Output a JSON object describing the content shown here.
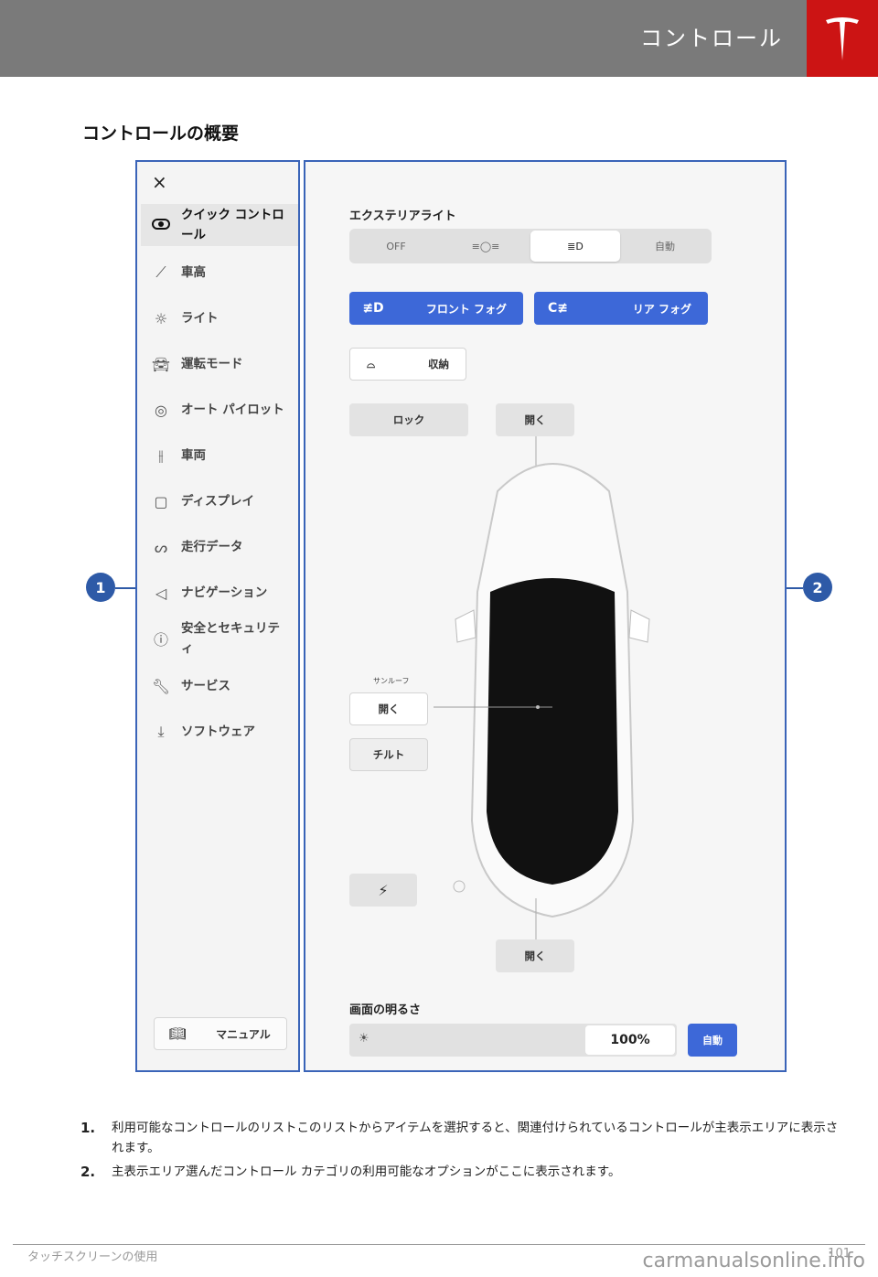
{
  "header": {
    "title": "コントロール",
    "logo": "tesla-logo"
  },
  "section_title": "コントロールの概要",
  "sidebar": {
    "close_icon": "×",
    "items": [
      {
        "label": "クイック コントロール",
        "icon": "toggle-icon"
      },
      {
        "label": "車高",
        "icon": "suspension-icon"
      },
      {
        "label": "ライト",
        "icon": "light-icon"
      },
      {
        "label": "運転モード",
        "icon": "car-icon"
      },
      {
        "label": "オート パイロット",
        "icon": "steering-wheel-icon"
      },
      {
        "label": "車両",
        "icon": "sliders-icon"
      },
      {
        "label": "ディスプレイ",
        "icon": "display-icon"
      },
      {
        "label": "走行データ",
        "icon": "trips-icon"
      },
      {
        "label": "ナビゲーション",
        "icon": "navigation-icon"
      },
      {
        "label": "安全とセキュリティ",
        "icon": "alert-icon"
      },
      {
        "label": "サービス",
        "icon": "wrench-icon"
      },
      {
        "label": "ソフトウェア",
        "icon": "download-icon"
      }
    ],
    "manual_label": "マニュアル"
  },
  "main": {
    "exterior_lights_label": "エクステリアライト",
    "light_options": [
      "OFF",
      "",
      "",
      "自動"
    ],
    "front_fog": "フロント フォグ",
    "rear_fog": "リア フォグ",
    "mirror_fold": "収納",
    "lock": "ロック",
    "frunk_open": "開く",
    "sunroof_label": "サンルーフ",
    "sunroof_open": "開く",
    "sunroof_tilt": "チルト",
    "trunk_open": "開く",
    "brightness_label": "画面の明るさ",
    "brightness_value": "100%",
    "brightness_auto": "自動"
  },
  "callouts": [
    "1",
    "2"
  ],
  "descriptions": [
    {
      "num": "1.",
      "text": "利用可能なコントロールのリストこのリストからアイテムを選択すると、関連付けられているコントロールが主表示エリアに表示されます。"
    },
    {
      "num": "2.",
      "text": "主表示エリア選んだコントロール カテゴリの利用可能なオプションがここに表示されます。"
    }
  ],
  "footer": {
    "left": "タッチスクリーンの使用",
    "right": "101"
  },
  "watermark": "carmanualsonline.info",
  "colors": {
    "accent_blue": "#3d68d8",
    "tesla_red": "#cc1414",
    "callout_blue": "#2e5aa7"
  }
}
